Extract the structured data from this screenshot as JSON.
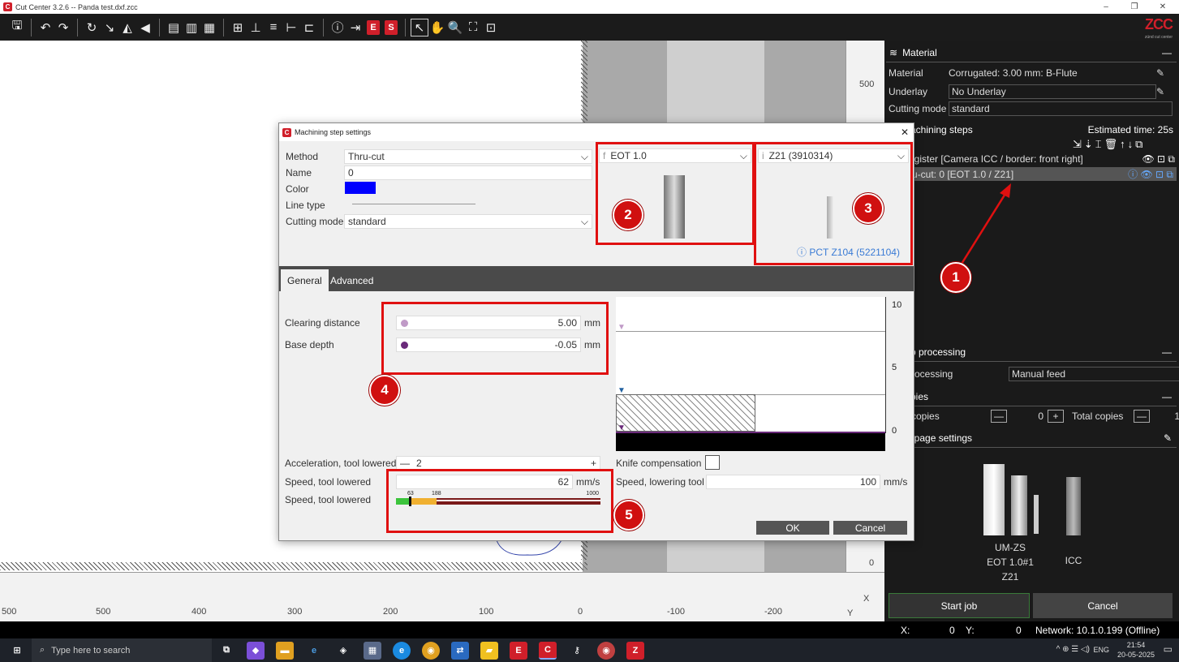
{
  "window": {
    "title": "Cut Center 3.2.6  --  Panda test.dxf.zcc",
    "brand": "ZCC",
    "brand_sub": "zünd cut center"
  },
  "ruler": {
    "x_ticks": [
      "500",
      "500",
      "400",
      "300",
      "200",
      "100",
      "0",
      "-100",
      "-200"
    ],
    "x_unit": "Y",
    "y_ticks": [
      "500",
      "0"
    ],
    "y_unit": "X"
  },
  "material_panel": {
    "header": "Material",
    "material_label": "Material",
    "material_value": "Corrugated: 3.00 mm: B-Flute",
    "underlay_label": "Underlay",
    "underlay_value": "No Underlay",
    "cutting_mode_label": "Cutting mode",
    "cutting_mode_value": "standard"
  },
  "machining_steps": {
    "header": "achining steps",
    "estimated": "Estimated time: 25s",
    "steps": [
      "egister [Camera ICC / border: front right]",
      "ru-cut: 0 [EOT 1.0 / Z21]"
    ]
  },
  "job_processing": {
    "header": "b processing",
    "processing_label": "rocessing",
    "processing_value": "Manual feed"
  },
  "copies": {
    "header": "pies",
    "copies_label": "copies",
    "copies_value": "0",
    "total_label": "Total copies",
    "total_value": "1"
  },
  "page_settings": {
    "label": "/ page settings"
  },
  "tools": {
    "module": "UM-ZS",
    "tool": "EOT 1.0#1",
    "blade": "Z21",
    "camera": "ICC"
  },
  "actions": {
    "start": "Start job",
    "cancel": "Cancel"
  },
  "status": {
    "x_label": "X:",
    "x_value": "0",
    "y_label": "Y:",
    "y_value": "0",
    "network": "Network: 10.1.0.199 (Offline)"
  },
  "dialog": {
    "title": "Machining step settings",
    "method_label": "Method",
    "method_value": "Thru-cut",
    "name_label": "Name",
    "name_value": "0",
    "color_label": "Color",
    "color_hex": "#0000ff",
    "linetype_label": "Line type",
    "cutting_mode_label": "Cutting mode",
    "cutting_mode_value": "standard",
    "tool_select": "EOT 1.0",
    "tool_prefix": "f",
    "blade_select": "Z21 (3910314)",
    "blade_prefix": "i",
    "blade_alt": "PCT Z104 (5221104)",
    "tabs": [
      "General",
      "Advanced"
    ],
    "clearing_label": "Clearing distance",
    "clearing_value": "5.00",
    "clearing_unit": "mm",
    "base_label": "Base depth",
    "base_value": "-0.05",
    "base_unit": "mm",
    "accel_label": "Acceleration, tool lowered",
    "accel_value": "2",
    "knife_label": "Knife compensation",
    "speed_label": "Speed, tool lowered",
    "speed_value": "62",
    "speed_unit": "mm/s",
    "speed_bar_label": "Speed, tool lowered",
    "speed_marks": [
      "63",
      "188",
      "1000"
    ],
    "speed_fraction": 0.062,
    "lower_label": "Speed, lowering tool",
    "lower_value": "100",
    "lower_unit": "mm/s",
    "depth_scale": [
      "10",
      "5",
      "0"
    ],
    "ok": "OK",
    "cancel": "Cancel"
  },
  "annotations": [
    "1",
    "2",
    "3",
    "4",
    "5"
  ],
  "taskbar": {
    "search": "Type here to search",
    "lang": "ENG",
    "time": "21:54",
    "date": "20-05-2025"
  }
}
